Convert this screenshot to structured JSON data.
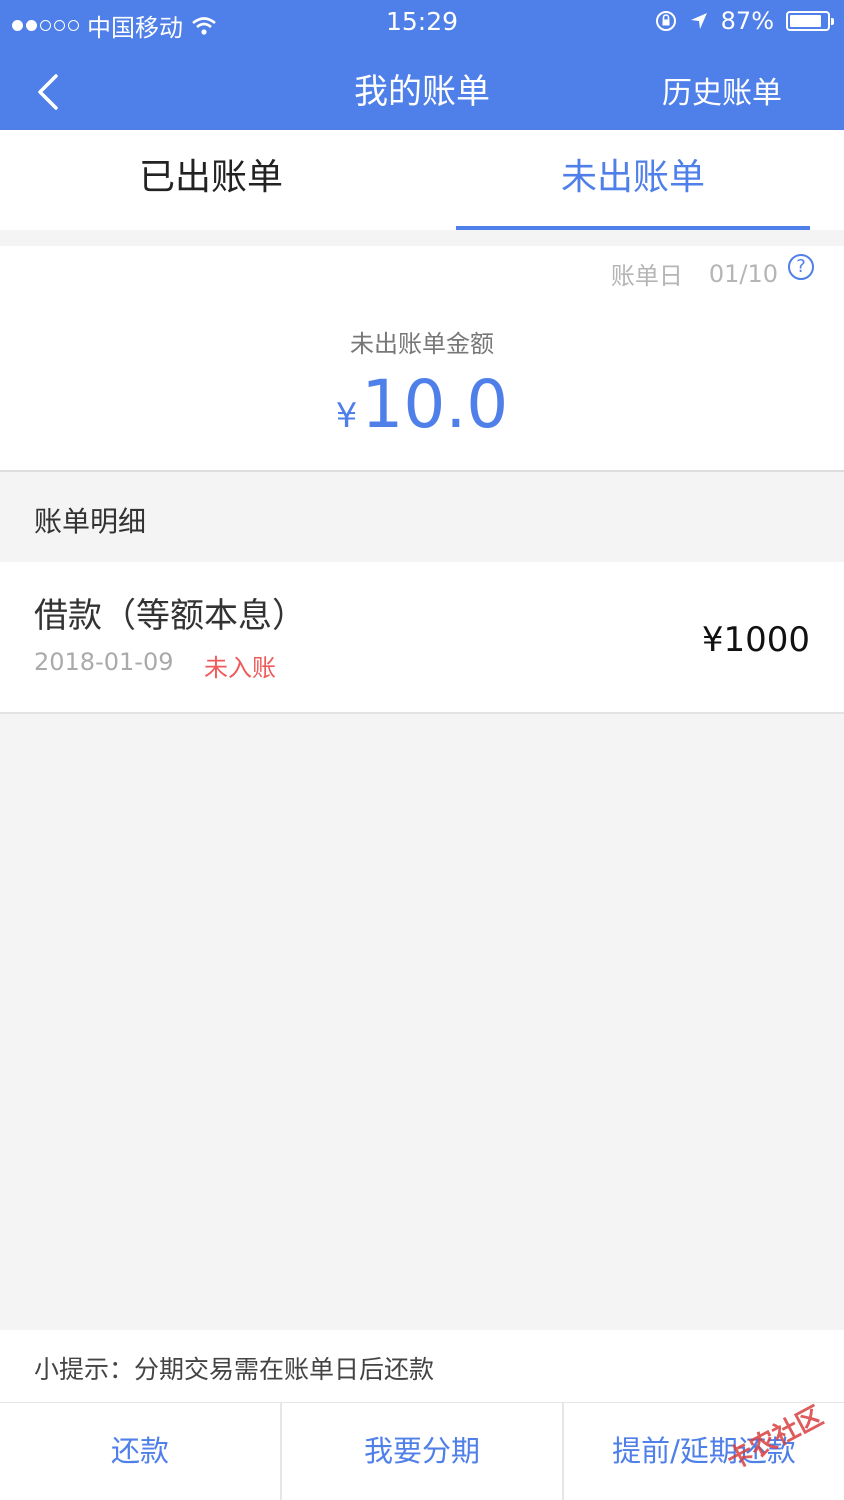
{
  "status_bar": {
    "carrier": "中国移动",
    "time": "15:29",
    "battery": "87%",
    "battery_level": 0.87
  },
  "nav": {
    "title": "我的账单",
    "right_label": "历史账单"
  },
  "tabs": [
    {
      "label": "已出账单",
      "active": false
    },
    {
      "label": "未出账单",
      "active": true
    }
  ],
  "summary": {
    "billday_label": "账单日",
    "billday_value": "01/10",
    "amount_label": "未出账单金额",
    "currency": "¥",
    "amount": "10.0"
  },
  "detail": {
    "section_title": "账单明细",
    "items": [
      {
        "name": "借款（等额本息）",
        "date": "2018-01-09",
        "status": "未入账",
        "amount": "¥1000"
      }
    ]
  },
  "tip": "小提示：分期交易需在账单日后还款",
  "actions": [
    {
      "label": "还款"
    },
    {
      "label": "我要分期"
    },
    {
      "label": "提前/延期还款"
    }
  ],
  "watermark": "卡农社区",
  "colors": {
    "accent": "#4f7fe8",
    "status_red": "#ef5a5a"
  }
}
